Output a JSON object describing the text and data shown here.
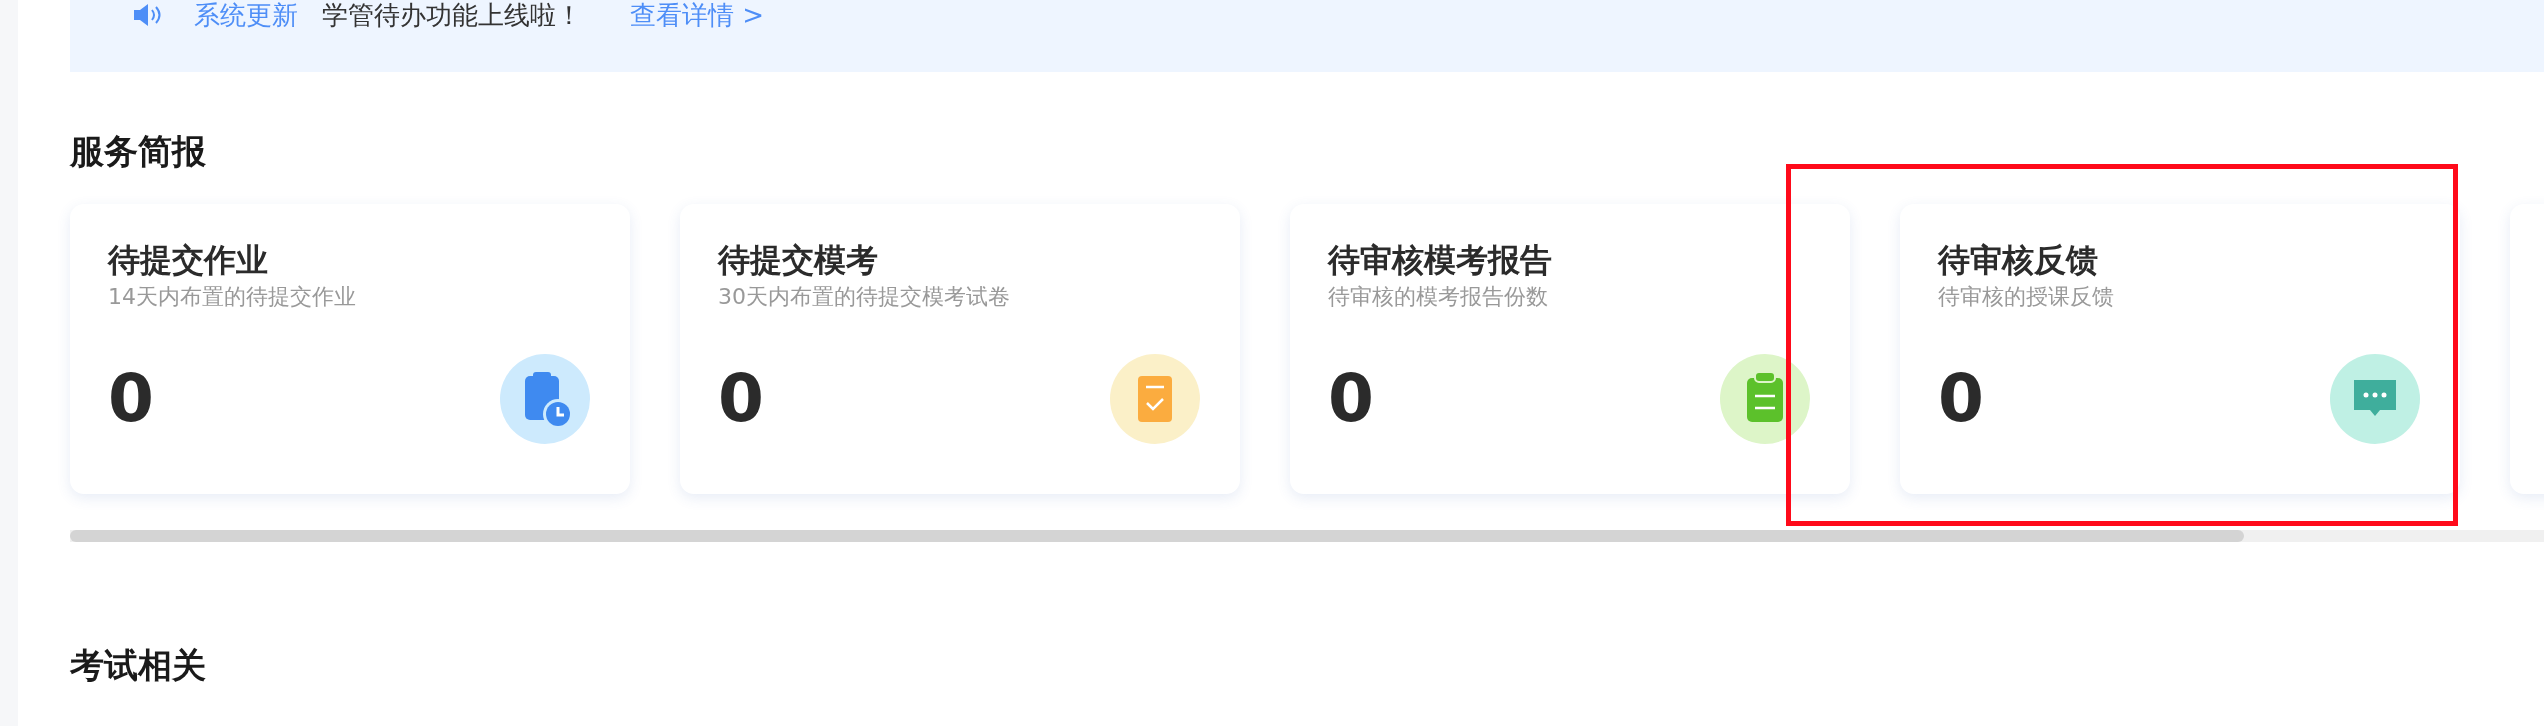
{
  "notice": {
    "tag": "系统更新",
    "message": "学管待办功能上线啦！",
    "link": "查看详情 >"
  },
  "summary": {
    "title": "服务简报",
    "cards": [
      {
        "title": "待提交作业",
        "subtitle": "14天内布置的待提交作业",
        "count": "0",
        "kind": "homework",
        "highlighted": false
      },
      {
        "title": "待提交模考",
        "subtitle": "30天内布置的待提交模考试卷",
        "count": "0",
        "kind": "exam",
        "highlighted": false
      },
      {
        "title": "待审核模考报告",
        "subtitle": "待审核的模考报告份数",
        "count": "0",
        "kind": "report",
        "highlighted": false
      },
      {
        "title": "待审核反馈",
        "subtitle": "待审核的授课反馈",
        "count": "0",
        "kind": "feedback",
        "highlighted": true
      }
    ]
  },
  "exam": {
    "title": "考试相关"
  }
}
